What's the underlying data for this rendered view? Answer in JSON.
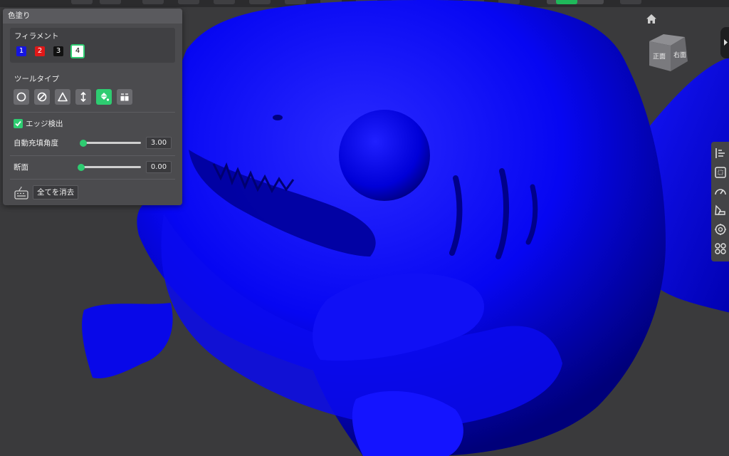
{
  "panel": {
    "title": "色塗り",
    "filament": {
      "label": "フィラメント",
      "chips": [
        {
          "label": "1",
          "color": "#1515e0"
        },
        {
          "label": "2",
          "color": "#e01818"
        },
        {
          "label": "3",
          "color": "#111111"
        },
        {
          "label": "4",
          "color": "#ffffff",
          "selected": true
        }
      ]
    },
    "tool_type": {
      "label": "ツールタイプ",
      "tools": [
        "circle-tool-icon",
        "sphere-tool-icon",
        "triangle-tool-icon",
        "height-range-tool-icon",
        "fill-tool-icon",
        "gap-fill-tool-icon"
      ],
      "active": "fill-tool-icon"
    },
    "edge_detect": {
      "label": "エッジ検出",
      "checked": true
    },
    "auto_fill_angle": {
      "label": "自動充填角度",
      "value": "3.00",
      "fraction": 0.03
    },
    "section": {
      "label": "断面",
      "value": "0.00",
      "fraction": 0.0
    },
    "clear_all": "全てを消去"
  },
  "viewcube": {
    "front": "正面",
    "right": "右面"
  },
  "right_toolbar": [
    "arrange-icon",
    "layout-icon",
    "speedometer-icon",
    "paint-icon",
    "support-icon",
    "assembly-icon"
  ],
  "model_color": "#0000ff",
  "accent": "#2ecc71"
}
